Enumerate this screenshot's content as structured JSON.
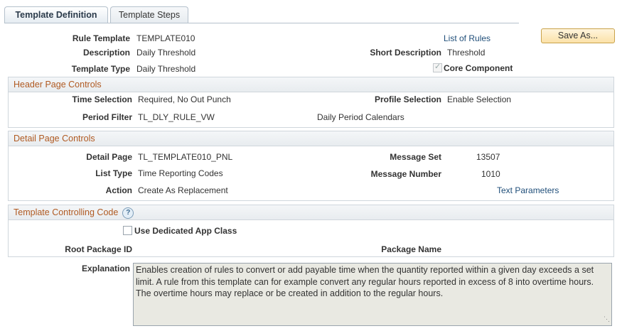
{
  "tabs": [
    {
      "label": "Template Definition"
    },
    {
      "label": "Template Steps"
    }
  ],
  "header": {
    "rule_template_label": "Rule Template",
    "rule_template_value": "TEMPLATE010",
    "list_of_rules_link": "List of Rules",
    "save_as_button": "Save As...",
    "description_label": "Description",
    "description_value": "Daily Threshold",
    "short_description_label": "Short Description",
    "short_description_value": "Threshold",
    "template_type_label": "Template Type",
    "template_type_value": "Daily Threshold",
    "core_component_label": "Core Component",
    "core_component_checked": true
  },
  "header_page_controls": {
    "title": "Header Page Controls",
    "time_selection_label": "Time Selection",
    "time_selection_value": "Required, No Out Punch",
    "profile_selection_label": "Profile Selection",
    "profile_selection_value": "Enable Selection",
    "period_filter_label": "Period Filter",
    "period_filter_value": "TL_DLY_RULE_VW",
    "period_filter_desc": "Daily Period Calendars"
  },
  "detail_page_controls": {
    "title": "Detail Page Controls",
    "detail_page_label": "Detail Page",
    "detail_page_value": "TL_TEMPLATE010_PNL",
    "message_set_label": "Message Set",
    "message_set_value": "13507",
    "list_type_label": "List Type",
    "list_type_value": "Time Reporting Codes",
    "message_number_label": "Message Number",
    "message_number_value": "1010",
    "action_label": "Action",
    "action_value": "Create As Replacement",
    "text_parameters_link": "Text Parameters"
  },
  "template_controlling_code": {
    "title": "Template Controlling Code",
    "help_icon": "?",
    "use_dedicated_label": "Use Dedicated App Class",
    "use_dedicated_checked": false,
    "root_package_label": "Root Package ID",
    "package_name_label": "Package Name"
  },
  "explanation": {
    "label": "Explanation",
    "text": "Enables creation of rules to convert or add payable time when the quantity reported within a given day exceeds a set limit.  A rule from this template can for example convert any regular hours reported in excess of 8 into overtime hours.  The overtime hours may replace or be created in addition to the regular hours."
  },
  "colors": {
    "section_title": "#b05a22",
    "link": "#1f4e79",
    "button_bg": "#fbe2a8"
  }
}
